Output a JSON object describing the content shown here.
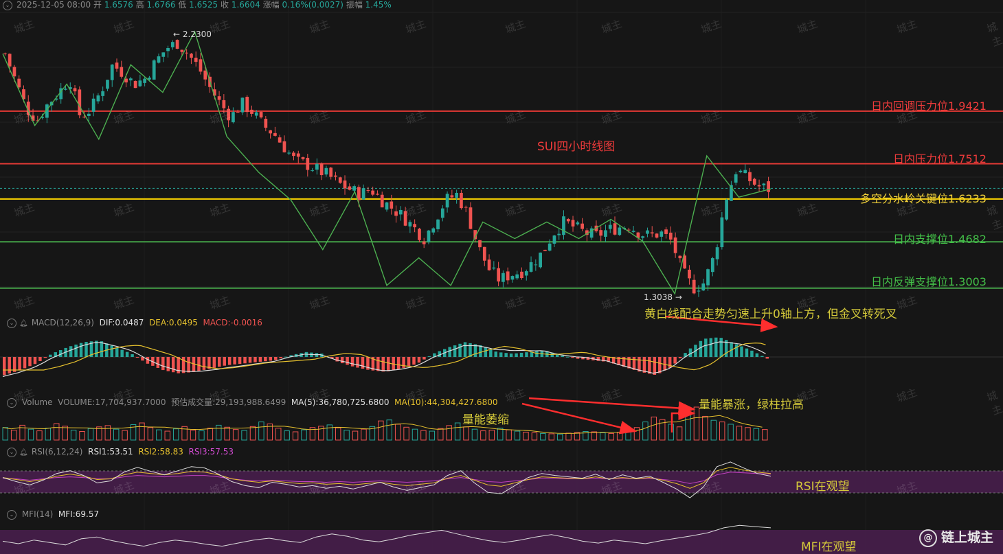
{
  "header": {
    "date": "2025-12-05 08:00",
    "open_label": "开",
    "open": "1.6576",
    "high_label": "高",
    "high": "1.6766",
    "low_label": "低",
    "low": "1.6525",
    "close_label": "收",
    "close": "1.6604",
    "change_label": "涨幅",
    "change": "0.16%(0.0027)",
    "amplitude_label": "振幅",
    "amplitude": "1.45%"
  },
  "chart_data": {
    "type": "candlestick",
    "title": "SUI四小时线图",
    "ylim": [
      1.21,
      2.3
    ],
    "high_marker": "2.2300",
    "low_marker": "1.3038",
    "levels": [
      {
        "label": "日内回调压力位1.9421",
        "value": 1.9421,
        "color": "#e53935"
      },
      {
        "label": "日内压力位1.7512",
        "value": 1.7512,
        "color": "#e53935"
      },
      {
        "label": "多空分水岭关键位1.6233",
        "value": 1.6233,
        "color": "#ffd600"
      },
      {
        "label": "日内支撑位1.4682",
        "value": 1.4682,
        "color": "#43a047"
      },
      {
        "label": "日内反弹支撑位1.3003",
        "value": 1.3003,
        "color": "#43a047"
      }
    ],
    "zigzag": [
      2.15,
      1.89,
      2.04,
      1.84,
      2.11,
      2.01,
      2.23,
      1.85,
      1.72,
      1.62,
      1.44,
      1.65,
      1.31,
      1.41,
      1.31,
      1.54,
      1.48,
      1.54,
      1.48,
      1.55,
      1.47,
      1.28,
      1.78,
      1.63,
      1.66
    ],
    "close_path": [
      2.15,
      2.05,
      1.95,
      1.91,
      1.97,
      2.01,
      2.06,
      1.92,
      1.95,
      2.02,
      2.11,
      2.08,
      2.04,
      2.06,
      2.12,
      2.17,
      2.19,
      2.15,
      2.1,
      2.03,
      1.97,
      1.92,
      1.97,
      1.94,
      1.89,
      1.86,
      1.81,
      1.76,
      1.75,
      1.73,
      1.71,
      1.68,
      1.66,
      1.64,
      1.66,
      1.62,
      1.59,
      1.56,
      1.52,
      1.48,
      1.55,
      1.62,
      1.64,
      1.57,
      1.45,
      1.37,
      1.33,
      1.35,
      1.36,
      1.39,
      1.43,
      1.5,
      1.54,
      1.52,
      1.5,
      1.49,
      1.51,
      1.52,
      1.53,
      1.5,
      1.49,
      1.5,
      1.47,
      1.36,
      1.3,
      1.32,
      1.42,
      1.62,
      1.73,
      1.7,
      1.67,
      1.66
    ],
    "macd": {
      "label": "MACD(12,26,9)",
      "dif_label": "DIF:0.0487",
      "dea_label": "DEA:0.0495",
      "macd_label": "MACD:-0.0016",
      "dif": -0.0008,
      "dea": -0.0004,
      "hist": [
        -0.055,
        -0.04,
        -0.02,
        0.01,
        0.03,
        0.045,
        0.05,
        0.03,
        0.01,
        -0.02,
        -0.04,
        -0.05,
        -0.045,
        -0.035,
        -0.025,
        -0.02,
        -0.015,
        -0.01,
        0.005,
        0.015,
        0.01,
        -0.015,
        -0.03,
        -0.04,
        -0.045,
        -0.035,
        -0.02,
        0.01,
        0.03,
        0.045,
        0.035,
        0.015,
        0.01,
        0.015,
        0.02,
        0.005,
        -0.005,
        -0.01,
        -0.015,
        -0.03,
        -0.045,
        -0.055,
        -0.03,
        0.02,
        0.055,
        0.06,
        0.04,
        0.02,
        -0.005
      ]
    },
    "volume": {
      "label": "Volume",
      "vol_label": "VOLUME:17,704,937.7000",
      "forecast_label": "预估成交量:29,193,988.6499",
      "ma5_label": "MA(5):36,780,725.6800",
      "ma10_label": "MA(10):44,304,427.6800",
      "bars": [
        38,
        30,
        45,
        33,
        28,
        36,
        50,
        42,
        30,
        26,
        35,
        40,
        44,
        33,
        29,
        47,
        52,
        38,
        31,
        27,
        34,
        41,
        30,
        28,
        36,
        45,
        39,
        32,
        29,
        41,
        55,
        49,
        36,
        28,
        25,
        31,
        38,
        42,
        46,
        37,
        30,
        27,
        33,
        41,
        58,
        61,
        48,
        39,
        33,
        29,
        27,
        35,
        44,
        52,
        40,
        33,
        28,
        30,
        36,
        31,
        27,
        24,
        22,
        20,
        19,
        18,
        21,
        23,
        26,
        25,
        22,
        20,
        24,
        30,
        38,
        55,
        70,
        62,
        48,
        40,
        85,
        100,
        72,
        60,
        55,
        48,
        42,
        38,
        35,
        32
      ]
    },
    "rsi": {
      "label": "RSI(6,12,24)",
      "rsi1_label": "RSI1:53.51",
      "rsi2_label": "RSI2:58.83",
      "rsi3_label": "RSI3:57.53",
      "rsi1": [
        52,
        46,
        41,
        48,
        58,
        62,
        55,
        44,
        47,
        60,
        67,
        61,
        56,
        62,
        68,
        66,
        57,
        46,
        40,
        37,
        45,
        42,
        38,
        40,
        36,
        39,
        35,
        40,
        45,
        38,
        33,
        37,
        41,
        55,
        62,
        44,
        30,
        28,
        40,
        52,
        58,
        55,
        53,
        51,
        57,
        49,
        56,
        51,
        54,
        45,
        35,
        22,
        38,
        68,
        75,
        66,
        58,
        54
      ],
      "rsi2": [
        52,
        49,
        46,
        49,
        54,
        57,
        54,
        49,
        50,
        56,
        60,
        58,
        56,
        58,
        61,
        60,
        56,
        50,
        47,
        45,
        47,
        45,
        43,
        44,
        42,
        43,
        41,
        43,
        45,
        42,
        40,
        42,
        44,
        51,
        55,
        48,
        41,
        39,
        44,
        49,
        53,
        52,
        51,
        50,
        53,
        50,
        52,
        50,
        52,
        48,
        43,
        36,
        44,
        62,
        67,
        63,
        60,
        58
      ],
      "rsi3": [
        51,
        50,
        48,
        50,
        52,
        53,
        52,
        50,
        50,
        53,
        55,
        54,
        53,
        54,
        55,
        55,
        53,
        50,
        48,
        47,
        48,
        47,
        46,
        46,
        45,
        46,
        45,
        46,
        47,
        46,
        45,
        46,
        47,
        50,
        52,
        49,
        46,
        45,
        47,
        49,
        51,
        51,
        50,
        50,
        51,
        50,
        51,
        50,
        51,
        49,
        47,
        43,
        47,
        56,
        60,
        59,
        58,
        57
      ]
    },
    "mfi": {
      "label": "MFI(14)",
      "mfi_label": "MFI:69.57",
      "values": [
        48,
        44,
        50,
        46,
        42,
        52,
        55,
        49,
        44,
        40,
        46,
        50,
        47,
        43,
        40,
        45,
        50,
        53,
        49,
        46,
        55,
        60,
        56,
        50,
        47,
        52,
        58,
        62,
        66,
        60,
        54,
        49,
        46,
        50,
        55,
        59,
        54,
        48,
        45,
        50,
        47,
        44,
        49,
        53,
        57,
        62,
        70,
        74,
        72,
        70
      ]
    }
  },
  "annotations": {
    "macd_note": "黄白线配合走势匀速上升0轴上方，但金叉转死叉",
    "volume_note_1": "量能萎缩",
    "volume_note_2": "量能暴涨，绿柱拉高",
    "rsi_note": "RSI在观望",
    "mfi_note": "MFI在观望"
  },
  "watermark": "城主",
  "brand": {
    "icon": "weibo-at-icon",
    "name": "链上城主"
  },
  "colors": {
    "up": "#26a69a",
    "down": "#ef5350",
    "zigzag": "#4caf50",
    "dif": "#dcdcdc",
    "dea": "#e6c12e",
    "rsi3": "#c040c0",
    "band": "#4a1f4f"
  }
}
